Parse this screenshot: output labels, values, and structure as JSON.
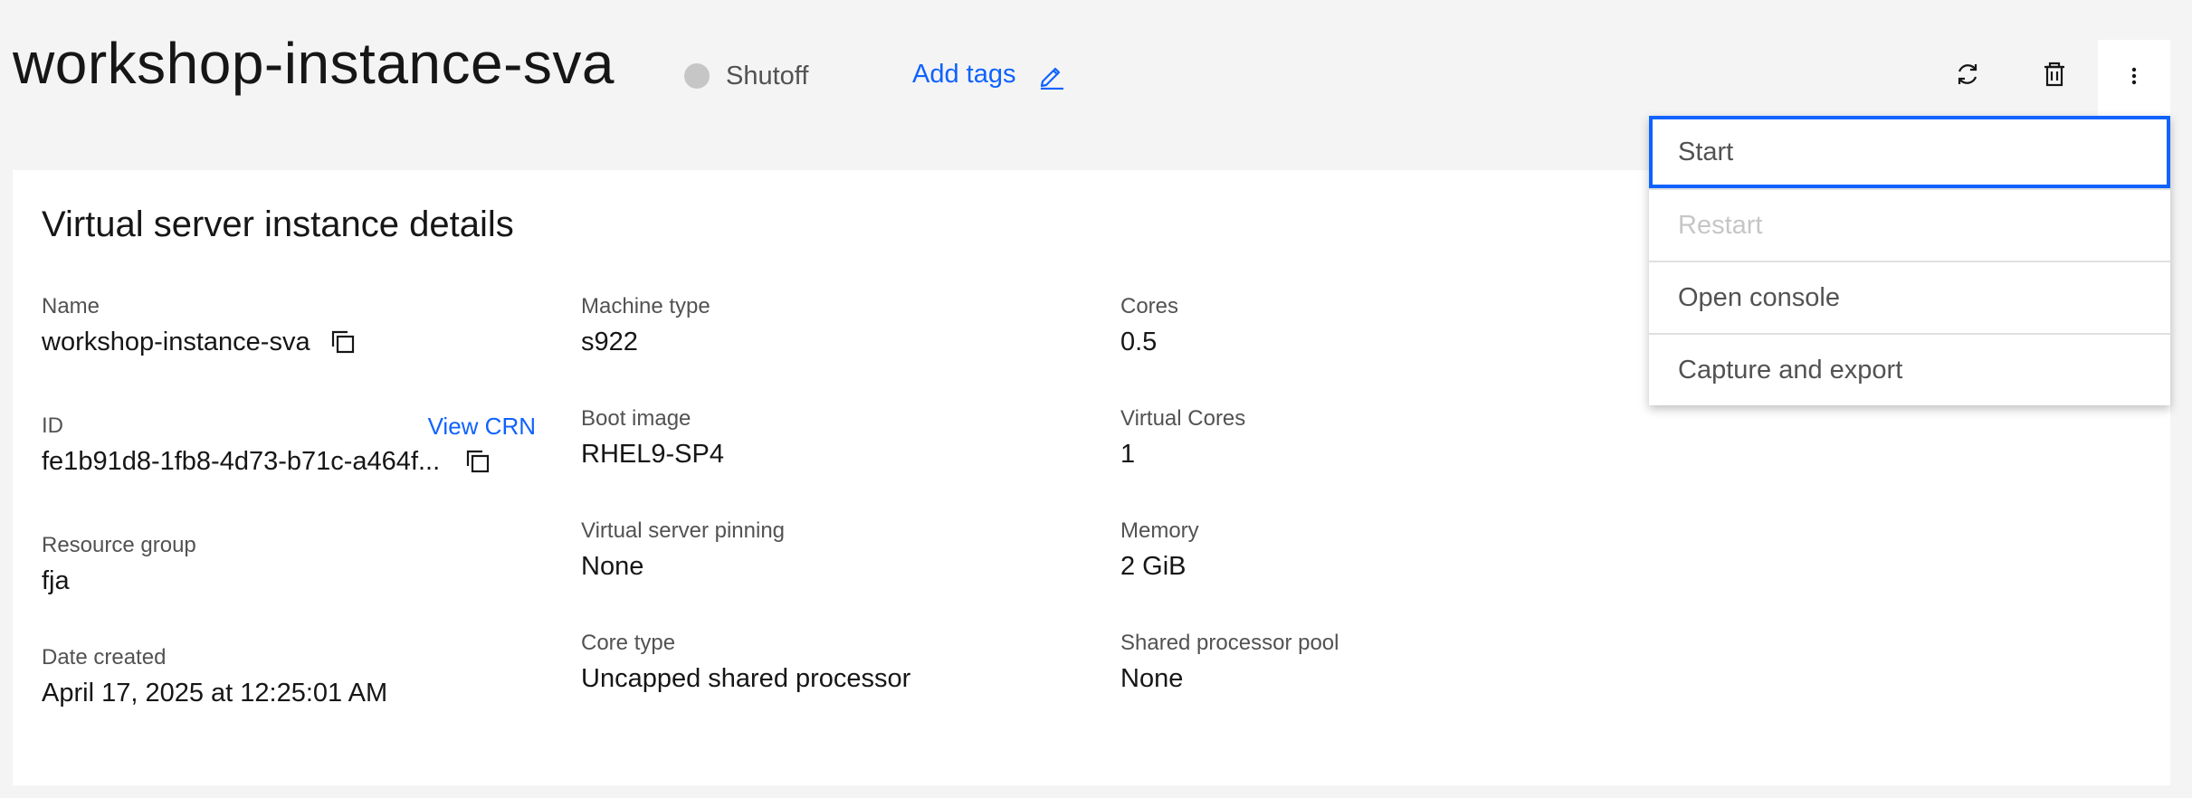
{
  "header": {
    "title": "workshop-instance-sva",
    "status": {
      "label": "Shutoff",
      "color": "#c6c6c6"
    },
    "add_tags_label": "Add tags",
    "actions": [
      {
        "icon": "refresh-icon"
      },
      {
        "icon": "trash-icon"
      },
      {
        "icon": "overflow-menu-icon"
      }
    ]
  },
  "details": {
    "title": "Virtual server instance details",
    "view_crn_label": "View CRN",
    "fields": {
      "name": {
        "label": "Name",
        "value": "workshop-instance-sva"
      },
      "id": {
        "label": "ID",
        "value": "fe1b91d8-1fb8-4d73-b71c-a464f..."
      },
      "resource_group": {
        "label": "Resource group",
        "value": "fja"
      },
      "date_created": {
        "label": "Date created",
        "value": "April 17, 2025 at 12:25:01 AM"
      },
      "machine_type": {
        "label": "Machine type",
        "value": "s922"
      },
      "boot_image": {
        "label": "Boot image",
        "value": "RHEL9-SP4"
      },
      "pinning": {
        "label": "Virtual server pinning",
        "value": "None"
      },
      "core_type": {
        "label": "Core type",
        "value": "Uncapped shared processor"
      },
      "cores": {
        "label": "Cores",
        "value": "0.5"
      },
      "virtual_cores": {
        "label": "Virtual Cores",
        "value": "1"
      },
      "memory": {
        "label": "Memory",
        "value": "2 GiB"
      },
      "shared_pool": {
        "label": "Shared processor pool",
        "value": "None"
      }
    }
  },
  "menu": {
    "items": [
      {
        "label": "Start",
        "state": "focused"
      },
      {
        "label": "Restart",
        "state": "disabled"
      },
      {
        "label": "Open console",
        "state": "enabled"
      },
      {
        "label": "Capture and export",
        "state": "enabled"
      }
    ]
  },
  "colors": {
    "accent": "#0f62fe",
    "background": "#f4f4f4",
    "surface": "#ffffff",
    "text_primary": "#161616",
    "text_secondary": "#525252",
    "disabled": "#c6c6c6"
  }
}
